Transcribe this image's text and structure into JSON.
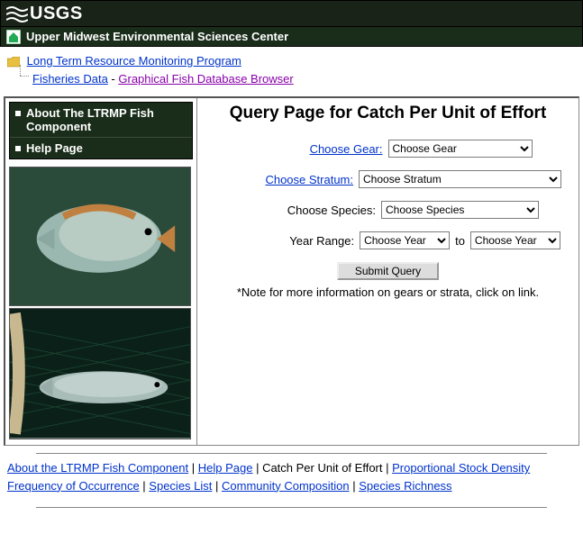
{
  "header": {
    "org": "USGS",
    "center": "Upper Midwest Environmental Sciences Center"
  },
  "breadcrumbs": {
    "level1": "Long Term Resource Monitoring Program",
    "level2a": "Fisheries Data",
    "sep": " - ",
    "level2b": "Graphical Fish Database Browser"
  },
  "sidebar": {
    "items": [
      {
        "label": "About The LTRMP Fish Component"
      },
      {
        "label": "Help Page"
      }
    ]
  },
  "main": {
    "title": "Query Page for Catch Per Unit of Effort",
    "gear_label": "Choose Gear:",
    "gear_selected": "Choose Gear",
    "stratum_label": "Choose Stratum:",
    "stratum_selected": "Choose Stratum",
    "species_label": "Choose Species:",
    "species_selected": "Choose Species",
    "year_label": "Year Range:",
    "year_from": "Choose Year",
    "year_to_sep": "to",
    "year_to": "Choose Year",
    "submit": "Submit Query",
    "note": "*Note for more information on gears or strata, click on link."
  },
  "footer": {
    "links": [
      "About the LTRMP Fish Component",
      "Help Page",
      "Catch Per Unit of Effort",
      "Proportional Stock Density",
      "Frequency of Occurrence",
      "Species List",
      "Community Composition",
      "Species Richness"
    ],
    "current": "Catch Per Unit of Effort"
  }
}
